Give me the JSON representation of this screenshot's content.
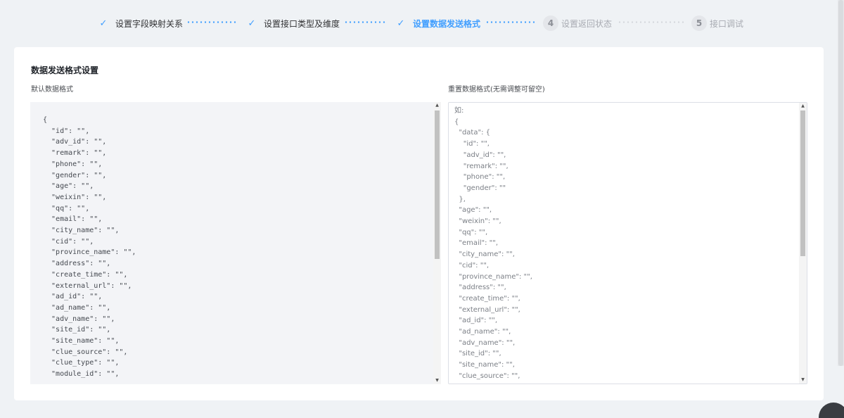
{
  "steps": [
    {
      "label": "设置字段映射关系",
      "status": "done",
      "icon": "check-icon"
    },
    {
      "label": "设置接口类型及维度",
      "status": "done",
      "icon": "check-icon"
    },
    {
      "label": "设置数据发送格式",
      "status": "active",
      "icon": "check-icon"
    },
    {
      "label": "设置返回状态",
      "status": "todo",
      "number": "4"
    },
    {
      "label": "接口调试",
      "status": "todo",
      "number": "5"
    }
  ],
  "check_glyph": "✓",
  "section_title": "数据发送格式设置",
  "left_label": "默认数据格式",
  "right_label": "重置数据格式(无需调整可留空)",
  "default_format": "{\n  \"id\": \"\",\n  \"adv_id\": \"\",\n  \"remark\": \"\",\n  \"phone\": \"\",\n  \"gender\": \"\",\n  \"age\": \"\",\n  \"weixin\": \"\",\n  \"qq\": \"\",\n  \"email\": \"\",\n  \"city_name\": \"\",\n  \"cid\": \"\",\n  \"province_name\": \"\",\n  \"address\": \"\",\n  \"create_time\": \"\",\n  \"external_url\": \"\",\n  \"ad_id\": \"\",\n  \"ad_name\": \"\",\n  \"adv_name\": \"\",\n  \"site_id\": \"\",\n  \"site_name\": \"\",\n  \"clue_source\": \"\",\n  \"clue_type\": \"\",\n  \"module_id\": \"\",",
  "reset_placeholder": "如:\n{\n  \"data\": {\n    \"id\": \"\",\n    \"adv_id\": \"\",\n    \"remark\": \"\",\n    \"phone\": \"\",\n    \"gender\": \"\"\n  },\n  \"age\": \"\",\n  \"weixin\": \"\",\n  \"qq\": \"\",\n  \"email\": \"\",\n  \"city_name\": \"\",\n  \"cid\": \"\",\n  \"province_name\": \"\",\n  \"address\": \"\",\n  \"create_time\": \"\",\n  \"external_url\": \"\",\n  \"ad_id\": \"\",\n  \"ad_name\": \"\",\n  \"adv_name\": \"\",\n  \"site_id\": \"\",\n  \"site_name\": \"\",\n  \"clue_source\": \"\",",
  "colors": {
    "accent": "#409eff",
    "pending": "#a8abb2",
    "page_bg": "#eff2f5",
    "code_bg": "#f3f4f7"
  }
}
